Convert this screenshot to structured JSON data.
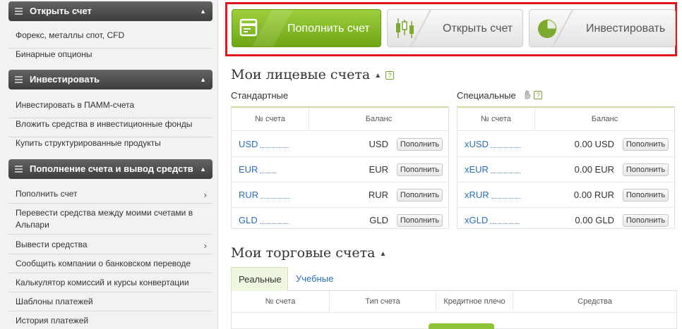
{
  "sidebar": {
    "sections": [
      {
        "title": "Открыть счет",
        "items": [
          "Форекс, металлы спот, CFD",
          "Бинарные опционы"
        ]
      },
      {
        "title": "Инвестировать",
        "items": [
          "Инвестировать в ПАММ-счета",
          "Вложить средства в инвестиционные фонды",
          "Купить структурированные продукты"
        ]
      },
      {
        "title": "Пополнение счета и вывод средств",
        "items": [
          "Пополнить счет",
          "Перевести средства между моими счетами в Альпари",
          "Вывести средства",
          "Сообщить компании о банковском переводе",
          "Калькулятор комиссий и курсы конвертации",
          "Шаблоны платежей",
          "История платежей"
        ]
      }
    ]
  },
  "actions": {
    "deposit": "Пополнить счет",
    "open": "Открыть счет",
    "invest": "Инвестировать"
  },
  "ledger": {
    "title": "Мои лицевые счета",
    "help": "?",
    "standard_title": "Стандартные",
    "special_title": "Специальные",
    "col_account": "№ счета",
    "col_balance": "Баланс",
    "topup_label": "Пополнить",
    "standard_rows": [
      {
        "account": "USD",
        "balance": "USD"
      },
      {
        "account": "EUR",
        "balance": "EUR"
      },
      {
        "account": "RUR",
        "balance": "RUR"
      },
      {
        "account": "GLD",
        "balance": "GLD"
      }
    ],
    "special_rows": [
      {
        "account": "xUSD",
        "balance": "0.00 USD"
      },
      {
        "account": "xEUR",
        "balance": "0.00 EUR"
      },
      {
        "account": "xRUR",
        "balance": "0.00 RUR"
      },
      {
        "account": "xGLD",
        "balance": "0.00 GLD"
      }
    ]
  },
  "trading": {
    "title": "Мои торговые счета",
    "tab_real": "Реальные",
    "tab_demo": "Учебные",
    "columns": [
      "№ счета",
      "Тип счета",
      "Кредитное плечо",
      "Средства"
    ]
  },
  "colors": {
    "accent_green": "#8fc43a",
    "link_blue": "#2a6fb5",
    "highlight_red": "#e2161e"
  }
}
